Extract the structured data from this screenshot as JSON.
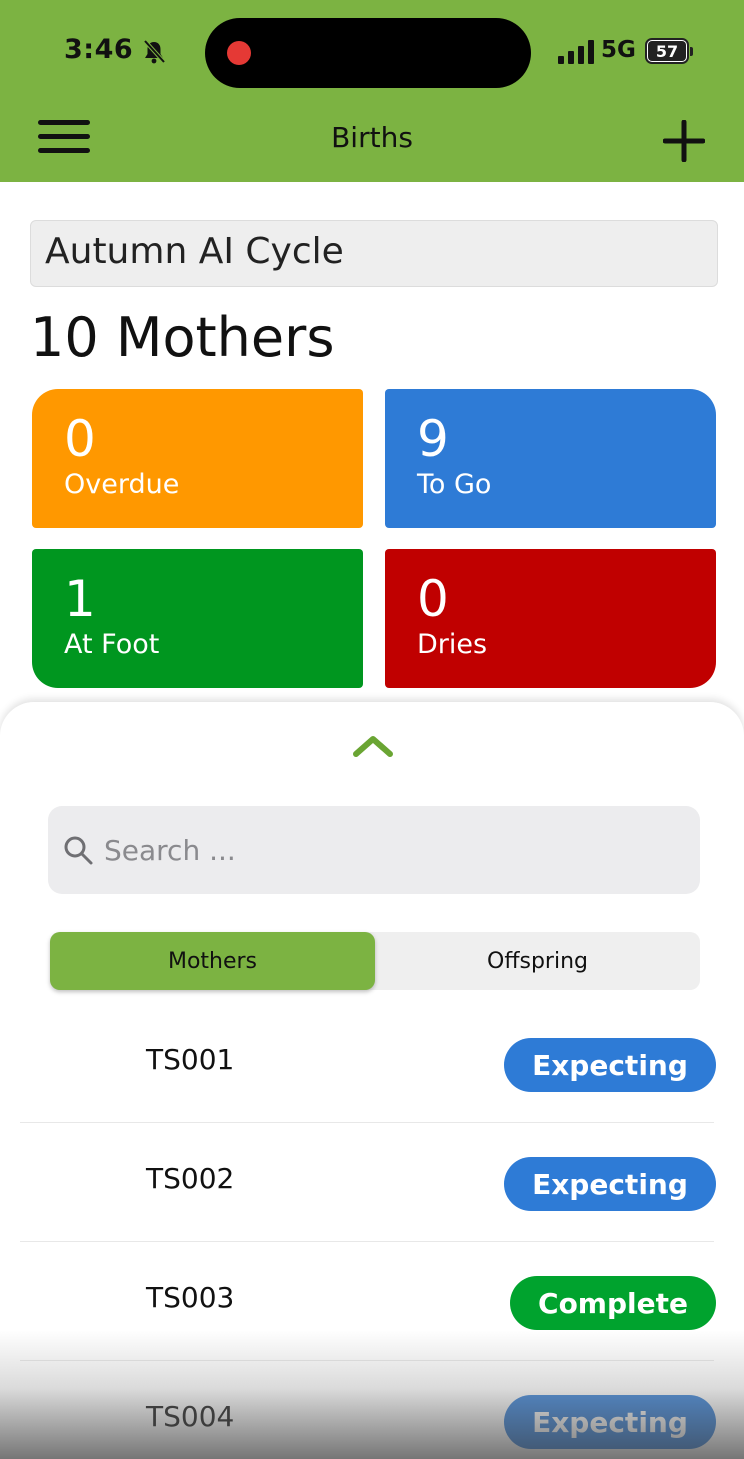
{
  "status_bar": {
    "time": "3:46",
    "network": "5G",
    "battery": "57"
  },
  "header": {
    "title": "Births"
  },
  "cycle": {
    "selected": "Autumn AI Cycle"
  },
  "summary": {
    "mothers_count_label": "10 Mothers",
    "tiles": [
      {
        "value": "0",
        "label": "Overdue",
        "color": "#ff9800"
      },
      {
        "value": "9",
        "label": "To Go",
        "color": "#2e7bd6"
      },
      {
        "value": "1",
        "label": "At Foot",
        "color": "#00961f"
      },
      {
        "value": "0",
        "label": "Dries",
        "color": "#c00000"
      }
    ]
  },
  "search": {
    "placeholder": "Search ..."
  },
  "segments": {
    "options": [
      "Mothers",
      "Offspring"
    ],
    "selected": "Mothers"
  },
  "list": [
    {
      "id": "TS001",
      "status": "Expecting"
    },
    {
      "id": "TS002",
      "status": "Expecting"
    },
    {
      "id": "TS003",
      "status": "Complete"
    },
    {
      "id": "TS004",
      "status": "Expecting"
    }
  ],
  "colors": {
    "brand": "#7cb342",
    "expecting": "#2e7bd6",
    "complete": "#00a32e"
  },
  "icons": [
    "bell-slash-icon",
    "signal-icon",
    "battery-icon",
    "menu-icon",
    "add-icon",
    "chevron-up-icon",
    "search-icon"
  ]
}
